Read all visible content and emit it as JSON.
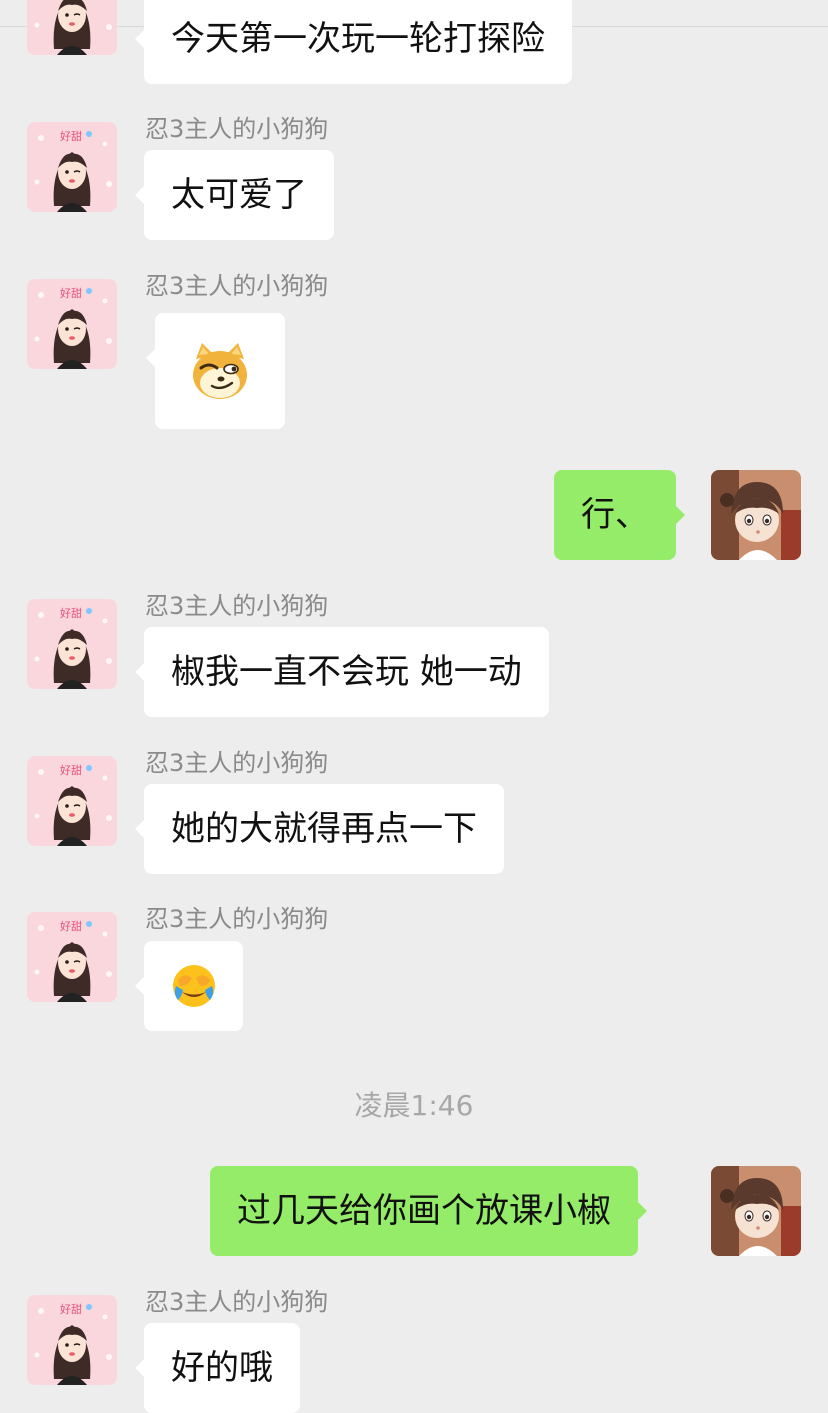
{
  "timestamp": "凌晨1:46",
  "messages": [
    {
      "side": "left",
      "sender": "",
      "text": "今天第一次玩一轮打探险"
    },
    {
      "side": "left",
      "sender": "忍3主人的小狗狗",
      "text": "太可爱了"
    },
    {
      "side": "left",
      "sender": "忍3主人的小狗狗",
      "sticker": "doge-smirk-icon"
    },
    {
      "side": "right",
      "text": "行、"
    },
    {
      "side": "left",
      "sender": "忍3主人的小狗狗",
      "text": "椒我一直不会玩 她一动"
    },
    {
      "side": "left",
      "sender": "忍3主人的小狗狗",
      "text": "她的大就得再点一下"
    },
    {
      "side": "left",
      "sender": "忍3主人的小狗狗",
      "emoji": "facepalm-emoji-icon"
    },
    {
      "side": "right",
      "text": "过几天给你画个放课小椒"
    },
    {
      "side": "left",
      "sender": "忍3主人的小狗狗",
      "text": "好的哦"
    }
  ],
  "colors": {
    "background": "#ededed",
    "incoming_bubble": "#ffffff",
    "outgoing_bubble": "#95ec69",
    "sender_text": "#8a8a8a"
  }
}
